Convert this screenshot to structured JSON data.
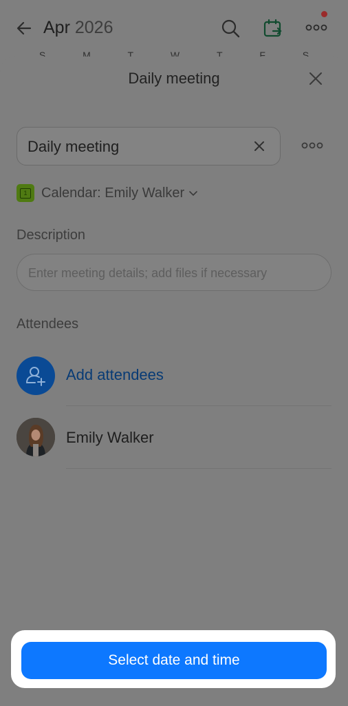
{
  "background": {
    "month": "Apr",
    "year": "2026",
    "weekdays": [
      "S",
      "M",
      "T",
      "W",
      "T",
      "F",
      "S"
    ],
    "icons": [
      "back-arrow-icon",
      "search-icon",
      "calendar-share-icon",
      "more-icon"
    ]
  },
  "sheet": {
    "title": "Daily meeting",
    "meeting_title_value": "Daily meeting",
    "calendar_label": "Calendar: Emily Walker",
    "calendar_day": "1",
    "description_label": "Description",
    "description_placeholder": "Enter meeting details; add files if necessary",
    "attendees_label": "Attendees",
    "add_attendees": "Add attendees",
    "attendees": [
      {
        "name": "Emily Walker"
      }
    ]
  },
  "footer": {
    "select_button": "Select date and time"
  },
  "colors": {
    "primary": "#0d78ff",
    "calendar_badge": "#86c01f",
    "notification_dot": "#e0403e"
  }
}
